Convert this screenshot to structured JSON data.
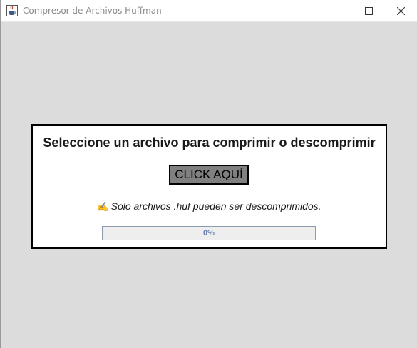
{
  "window": {
    "title": "Compresor de Archivos Huffman",
    "app_icon": "java-cup-icon",
    "controls": {
      "minimize_icon": "minimize-icon",
      "maximize_icon": "maximize-icon",
      "close_icon": "close-icon"
    }
  },
  "panel": {
    "heading": "Seleccione un archivo para comprimir o descomprimir",
    "button_label": "CLICK AQUÍ",
    "note_icon": "writing-hand-icon",
    "note_text": "Solo archivos .huf pueden ser descomprimidos.",
    "progress": {
      "value": 0,
      "label": "0%"
    }
  },
  "colors": {
    "background": "#dcdcdc",
    "button": "#808080",
    "progress_text": "#6a7fae"
  }
}
